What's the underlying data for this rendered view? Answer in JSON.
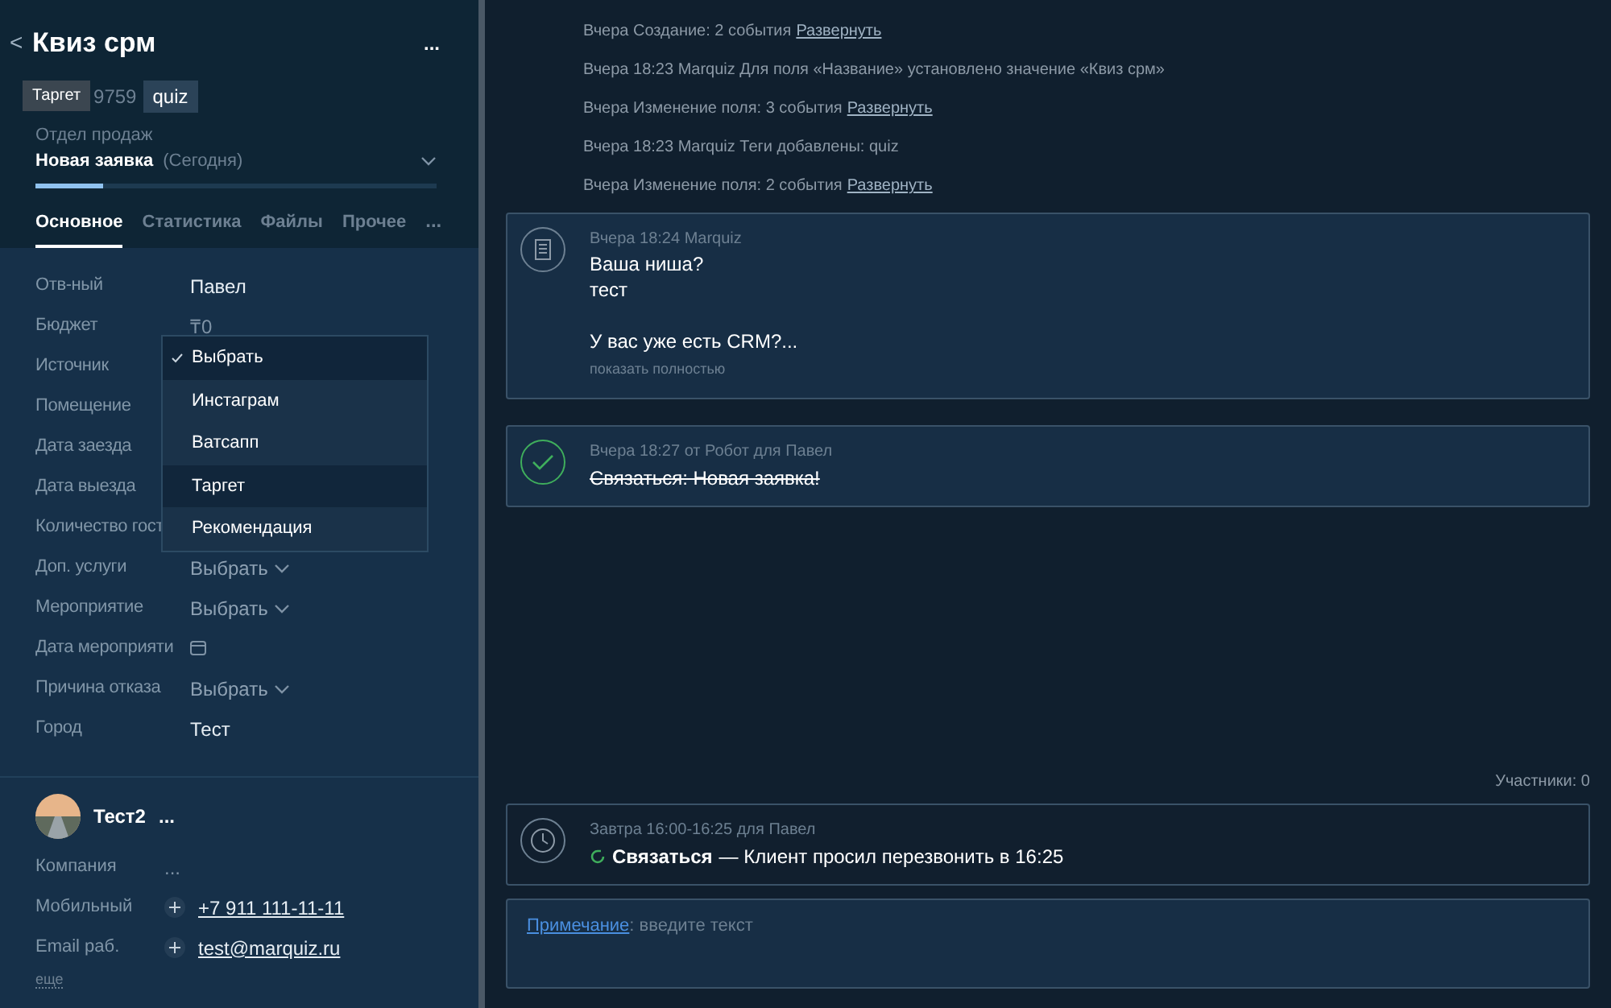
{
  "header": {
    "back": "<",
    "title": "Квиз срм",
    "more": "...",
    "id_visible": "9759",
    "tag": "quiz",
    "tooltip": "Таргет"
  },
  "pipeline": {
    "name": "Отдел продаж",
    "stage": "Новая заявка",
    "date": "(Сегодня)",
    "level": 0.17
  },
  "tabs": [
    {
      "label": "Основное",
      "selected": true
    },
    {
      "label": "Статистика",
      "selected": false
    },
    {
      "label": "Файлы",
      "selected": false
    },
    {
      "label": "Прочее",
      "selected": false
    }
  ],
  "tabs_more": "...",
  "fields": [
    {
      "label": "Отв-ный",
      "kind": "text",
      "value": "Павел"
    },
    {
      "label": "Бюджет",
      "kind": "muted",
      "value": "₸0"
    },
    {
      "label": "Источник",
      "kind": "hidden"
    },
    {
      "label": "Помещение",
      "kind": "hidden"
    },
    {
      "label": "Дата заезда",
      "kind": "hidden"
    },
    {
      "label": "Дата выезда",
      "kind": "hidden"
    },
    {
      "label": "Количество гост",
      "kind": "hidden"
    },
    {
      "label": "Доп. услуги",
      "kind": "select",
      "value": "Выбрать"
    },
    {
      "label": "Мероприятие",
      "kind": "select",
      "value": "Выбрать"
    },
    {
      "label": "Дата мероприяти",
      "kind": "date"
    },
    {
      "label": "Причина отказа",
      "kind": "select",
      "value": "Выбрать"
    },
    {
      "label": "Город",
      "kind": "text",
      "value": "Тест"
    }
  ],
  "dropdown": [
    {
      "label": "Выбрать",
      "checked": true,
      "highlighted": false
    },
    {
      "label": "Инстаграм",
      "checked": false,
      "highlighted": false
    },
    {
      "label": "Ватсапп",
      "checked": false,
      "highlighted": false
    },
    {
      "label": "Таргет",
      "checked": false,
      "highlighted": true
    },
    {
      "label": "Рекомендация",
      "checked": false,
      "highlighted": false
    }
  ],
  "contact": {
    "name": "Тест2",
    "more": "...",
    "fields": [
      {
        "label": "Компания",
        "kind": "muted",
        "value": "..."
      },
      {
        "label": "Мобильный",
        "kind": "link",
        "value": "+7 911 111-11-11"
      },
      {
        "label": "Email раб.",
        "kind": "link",
        "value": "test@marquiz.ru"
      }
    ],
    "more_link": "еще"
  },
  "events": [
    {
      "text": "Вчера Создание: 2 события",
      "link": "Развернуть"
    },
    {
      "text": "Вчера 18:23 Marquiz Для поля «Название» установлено значение «Квиз срм»"
    },
    {
      "text": "Вчера Изменение поля: 3 события",
      "link": "Развернуть"
    },
    {
      "text": "Вчера 18:23 Marquiz Теги добавлены: quiz"
    },
    {
      "text": "Вчера Изменение поля: 2 события",
      "link": "Развернуть"
    }
  ],
  "note": {
    "meta": "Вчера 18:24 Marquiz",
    "paragraphs": [
      [
        "Ваша ниша?",
        "тест"
      ],
      [
        "У вас уже есть CRM?..."
      ]
    ],
    "show_more": "показать полностью"
  },
  "done_task": {
    "meta": "Вчера 18:27  от Робот для Павел",
    "text": "Связаться: Новая заявка!",
    "completed": true
  },
  "participants": "Участники: 0",
  "task": {
    "meta": "Завтра 16:00-16:25 для Павел",
    "type": "Связаться",
    "text": "— Клиент просил перезвонить в 16:25"
  },
  "composer": {
    "link": "Примечание",
    "placeholder": ": введите текст"
  }
}
